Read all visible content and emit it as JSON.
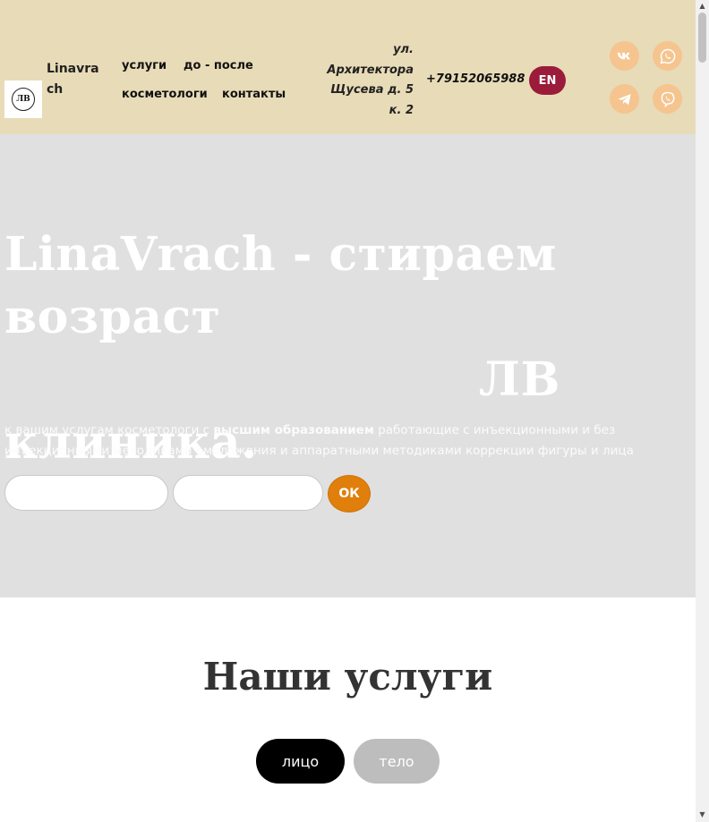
{
  "header": {
    "logo_text": "ЛВ",
    "brand": "Linavrach",
    "nav": {
      "services": "услуги",
      "before_after": "до - после",
      "cosmetologists": "косметологи",
      "contacts": "контакты"
    },
    "address": "ул. Архитектора Щусева д. 5 к. 2",
    "phone": "+79152065988",
    "lang": "EN",
    "social": [
      "vk-icon",
      "whatsapp-icon",
      "telegram-icon",
      "viber-icon"
    ]
  },
  "hero": {
    "title_main": "LinaVrach - стираем возраст",
    "title_accent": "ЛВ",
    "title_end": "клиника.",
    "sub_pre": "к вашим услугам косметологи с ",
    "sub_bold": "высшим образованием",
    "sub_post": " работающие с инъекционными и без инъекционными методиками омоложения и аппаратными методиками коррекции фигуры и лица",
    "input1_value": "",
    "input2_value": "",
    "ok_label": "ОК"
  },
  "services": {
    "title": "Наши услуги",
    "tabs": [
      "лицо",
      "тело"
    ]
  },
  "colors": {
    "header_bg": "#e8dbb7",
    "hero_bg": "#e0e0e0",
    "lang_btn": "#9b1b3a",
    "social_bg": "#f5c48f",
    "ok_btn": "#e07f0c"
  }
}
